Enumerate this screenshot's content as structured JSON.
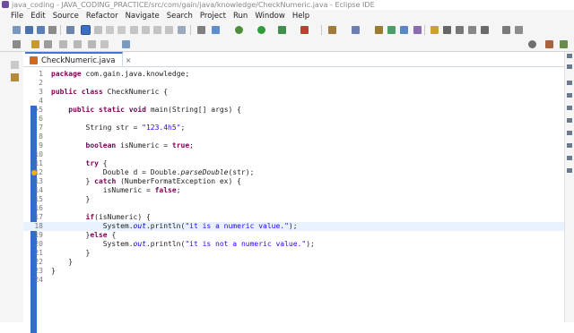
{
  "window": {
    "title": "java_coding - JAVA_CODING_PRACTICE/src/com/gain/java/knowledge/CheckNumeric.java - Eclipse IDE"
  },
  "menu": [
    "File",
    "Edit",
    "Source",
    "Refactor",
    "Navigate",
    "Search",
    "Project",
    "Run",
    "Window",
    "Help"
  ],
  "editor": {
    "tab_label": "CheckNumeric.java",
    "tab_close": "×",
    "current_line": 18
  },
  "code_lines": [
    {
      "n": "1",
      "parts": [
        [
          "kw",
          "package"
        ],
        [
          "",
          "com.gain.java.knowledge;"
        ]
      ]
    },
    {
      "n": "2",
      "parts": []
    },
    {
      "n": "3",
      "parts": [
        [
          "kw",
          "public"
        ],
        [
          "",
          ""
        ],
        [
          "kw",
          "class"
        ],
        [
          "",
          "CheckNumeric {"
        ]
      ]
    },
    {
      "n": "4",
      "parts": []
    },
    {
      "n": "5",
      "fold": "⊖",
      "parts": [
        [
          "",
          "    "
        ],
        [
          "kw",
          "public"
        ],
        [
          "",
          ""
        ],
        [
          "kw",
          "static"
        ],
        [
          "",
          ""
        ],
        [
          "kw",
          "void"
        ],
        [
          "",
          "main(String[] args) {"
        ]
      ]
    },
    {
      "n": "6",
      "parts": []
    },
    {
      "n": "7",
      "parts": [
        [
          "",
          "        String str = "
        ],
        [
          "str",
          "\"123.4h5\""
        ],
        [
          "",
          ";"
        ]
      ]
    },
    {
      "n": "8",
      "parts": []
    },
    {
      "n": "9",
      "parts": [
        [
          "",
          "        "
        ],
        [
          "kw",
          "boolean"
        ],
        [
          "",
          "isNumeric = "
        ],
        [
          "kw",
          "true"
        ],
        [
          "",
          ";"
        ]
      ]
    },
    {
      "n": "10",
      "parts": []
    },
    {
      "n": "11",
      "parts": [
        [
          "",
          "        "
        ],
        [
          "kw",
          "try"
        ],
        [
          "",
          " {"
        ]
      ]
    },
    {
      "n": "12",
      "warn": true,
      "parts": [
        [
          "",
          "            Double d = Double."
        ],
        [
          "mth",
          "parseDouble"
        ],
        [
          "",
          "(str);"
        ]
      ]
    },
    {
      "n": "13",
      "parts": [
        [
          "",
          "        } "
        ],
        [
          "kw",
          "catch"
        ],
        [
          "",
          " (NumberFormatException ex) {"
        ]
      ]
    },
    {
      "n": "14",
      "parts": [
        [
          "",
          "            isNumeric = "
        ],
        [
          "kw",
          "false"
        ],
        [
          "",
          ";"
        ]
      ]
    },
    {
      "n": "15",
      "parts": [
        [
          "",
          "        }"
        ]
      ]
    },
    {
      "n": "16",
      "parts": []
    },
    {
      "n": "17",
      "parts": [
        [
          "",
          "        "
        ],
        [
          "kw",
          "if"
        ],
        [
          "",
          "(isNumeric) {"
        ]
      ]
    },
    {
      "n": "18",
      "parts": [
        [
          "",
          "            System."
        ],
        [
          "fld",
          "out"
        ],
        [
          "",
          ".println("
        ],
        [
          "str",
          "\"it is a numeric value.\""
        ],
        [
          "",
          ");"
        ]
      ]
    },
    {
      "n": "19",
      "parts": [
        [
          "",
          "        }"
        ],
        [
          "kw",
          "else"
        ],
        [
          "",
          " {"
        ]
      ]
    },
    {
      "n": "20",
      "parts": [
        [
          "",
          "            System."
        ],
        [
          "fld",
          "out"
        ],
        [
          "",
          ".println("
        ],
        [
          "str",
          "\"it is not a numeric value.\""
        ],
        [
          "",
          ");"
        ]
      ]
    },
    {
      "n": "21",
      "parts": [
        [
          "",
          "        }"
        ]
      ]
    },
    {
      "n": "22",
      "parts": [
        [
          "",
          "    }"
        ]
      ]
    },
    {
      "n": "23",
      "parts": [
        [
          "",
          "}"
        ]
      ]
    },
    {
      "n": "24",
      "parts": []
    }
  ],
  "colors": {
    "keyword": "#7f0055",
    "string": "#2a00ff",
    "field": "#0000c0",
    "current_line": "#e8f2fe",
    "ruler": "#2f6fc9"
  },
  "icons": {
    "toolbar_row1": [
      "new-icon",
      "save-icon",
      "save-all-icon",
      "print-icon",
      "skip-breakpoints-icon",
      "suspend-icon",
      "resume-icon",
      "terminate-icon",
      "disconnect-icon",
      "step-into-icon",
      "step-over-icon",
      "step-return-icon",
      "drop-to-frame-icon",
      "debug-icon",
      "run-icon",
      "coverage-icon",
      "external-tools-icon",
      "new-java-project-icon",
      "new-package-icon",
      "new-class-icon",
      "open-type-icon",
      "search-icon",
      "toggle-mark-occurrences-icon",
      "toggle-breadcrumb-icon",
      "next-annotation-icon",
      "prev-annotation-icon",
      "last-edit-icon",
      "back-icon",
      "forward-icon",
      "pin-editor-icon"
    ],
    "toolbar_row2": [
      "perspective-java-icon",
      "perspective-debug-icon",
      "quick-access-icon"
    ]
  }
}
